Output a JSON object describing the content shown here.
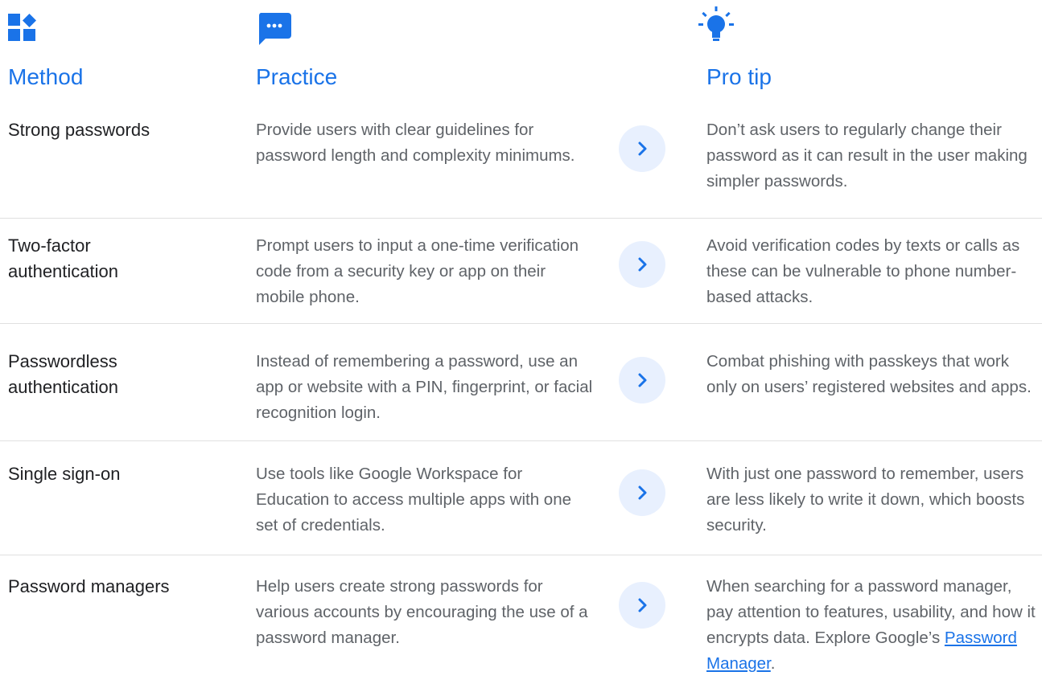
{
  "headers": {
    "method": "Method",
    "practice": "Practice",
    "tip": "Pro tip"
  },
  "icons": {
    "method": "shapes-icon",
    "practice": "chat-bubble-icon",
    "tip": "lightbulb-icon",
    "row_action": "chevron-right-icon"
  },
  "colors": {
    "accent": "#1a73e8",
    "chevron_bg": "#e8f0fe"
  },
  "rows": [
    {
      "method": "Strong passwords",
      "practice": "Provide users with clear guidelines for password length and complexity minimums.",
      "tip": "Don’t ask users to regularly change their password as it can result in the user making simpler passwords."
    },
    {
      "method": "Two-factor authentication",
      "practice": "Prompt users to input a one-time verification code from a security key or app on their mobile phone.",
      "tip": "Avoid verification codes by texts or calls as these can be vulnerable to phone number-based attacks."
    },
    {
      "method": "Passwordless authentication",
      "practice": "Instead of remembering a password, use an app or website with a PIN, fingerprint, or facial recognition login.",
      "tip": "Combat phishing with passkeys that work only on users’ registered websites and apps."
    },
    {
      "method": "Single sign-on",
      "practice": "Use tools like Google Workspace for Education to access multiple apps with one set of credentials.",
      "tip": "With just one password to remember, users are less likely to write it down, which boosts security."
    },
    {
      "method": "Password managers",
      "practice": "Help users create strong passwords for various accounts by encouraging the use of a password manager.",
      "tip": "When searching for a password manager, pay attention to features, usability, and how it encrypts data. Explore Google’s ",
      "tip_link": "Password Manager",
      "tip_end": "."
    }
  ]
}
